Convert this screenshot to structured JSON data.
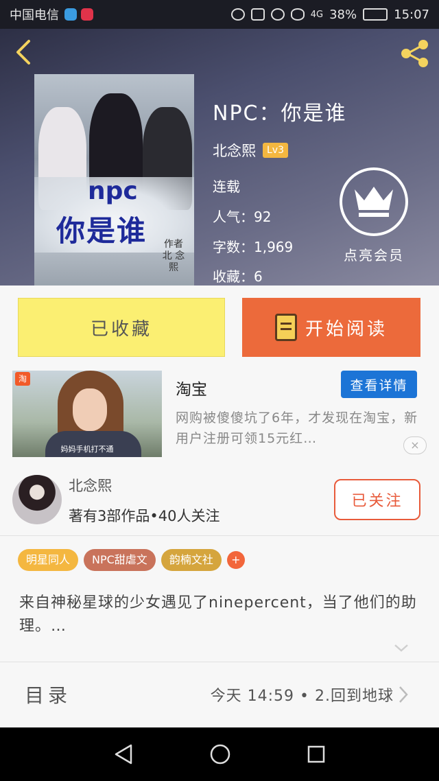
{
  "status_bar": {
    "carrier": "中国电信",
    "battery": "38%",
    "time": "15:07",
    "network": "4G",
    "battery_level": 0.38
  },
  "book": {
    "title": "NPC：你是谁",
    "author": "北念熙",
    "level": "Lv3",
    "status": "连载",
    "popularity": "人气：92",
    "words": "字数：1,969",
    "favorites": "收藏：6",
    "cover_title_1": "npc",
    "cover_title_2": "你是谁",
    "cover_author": "作者 北 念熙"
  },
  "vip": {
    "label": "点亮会员"
  },
  "actions": {
    "collect": "已收藏",
    "read": "开始阅读"
  },
  "ad": {
    "title": "淘宝",
    "detail": "查看详情",
    "desc": "网购被傻傻坑了6年，才发现在淘宝，新用户注册可领15元红…",
    "caption": "妈妈手机打不通",
    "logo": "淘",
    "close": "×"
  },
  "author_card": {
    "name": "北念熙",
    "stats": "著有3部作品•40人关注",
    "follow": "已关注"
  },
  "tags": [
    {
      "label": "明星同人",
      "color": "#f4b740"
    },
    {
      "label": "NPC甜虐文",
      "color": "#c9735b"
    },
    {
      "label": "韵楠文社",
      "color": "#d5a53d"
    }
  ],
  "tag_add": "+",
  "summary": "来自神秘星球的少女遇见了ninepercent，当了他们的助理。…",
  "toc": {
    "label": "目录",
    "latest": "今天 14:59 • 2.回到地球"
  }
}
